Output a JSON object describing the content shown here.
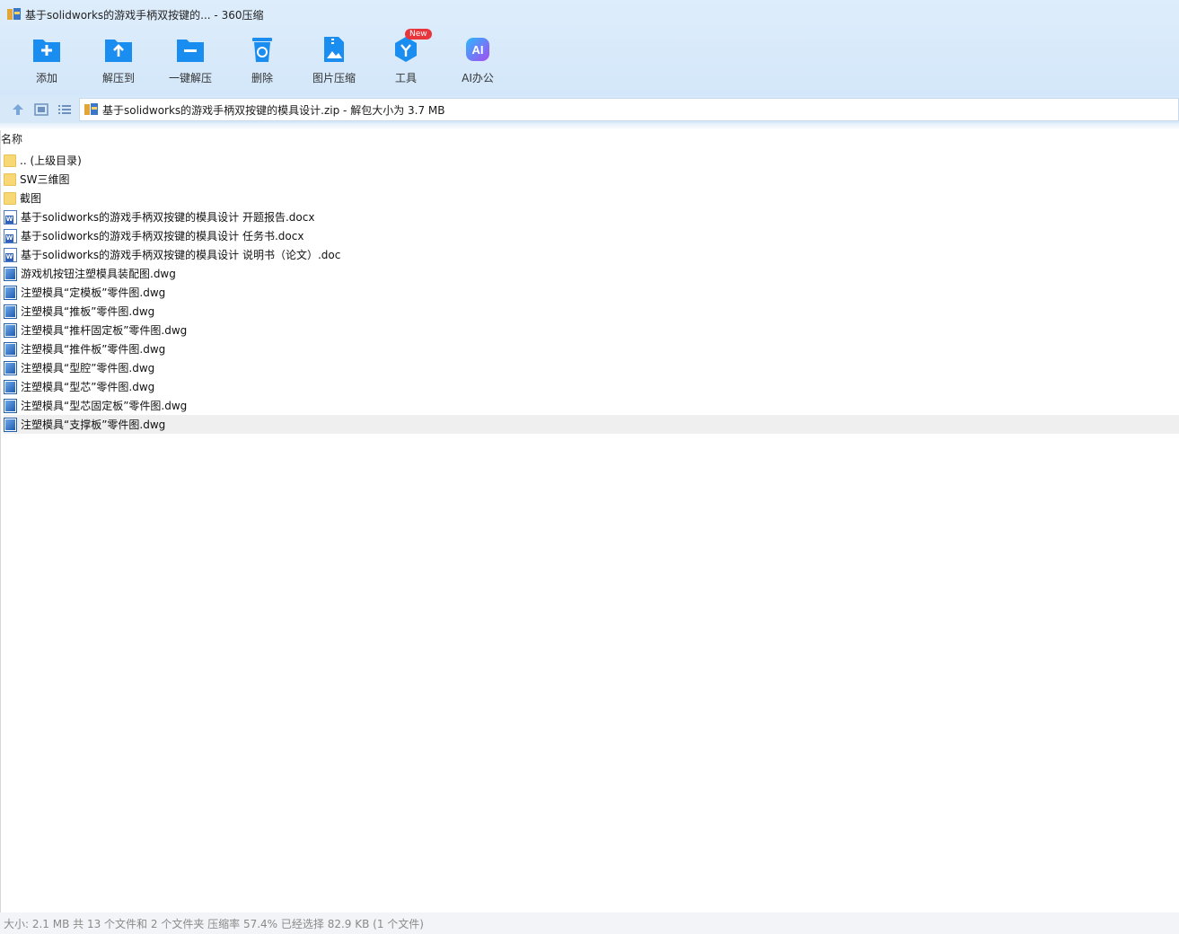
{
  "window": {
    "title": "基于solidworks的游戏手柄双按键的... - 360压缩"
  },
  "colors": {
    "accent": "#1a8ef0",
    "badge": "#e8343b",
    "topbar": "#d8eafa"
  },
  "toolbar": [
    {
      "label": "添加",
      "icon": "add-folder-icon"
    },
    {
      "label": "解压到",
      "icon": "extract-to-icon"
    },
    {
      "label": "一键解压",
      "icon": "one-click-extract-icon"
    },
    {
      "label": "删除",
      "icon": "delete-trash-icon"
    },
    {
      "label": "图片压缩",
      "icon": "image-compress-icon"
    },
    {
      "label": "工具",
      "icon": "tools-icon",
      "badge": "New"
    },
    {
      "label": "AI办公",
      "icon": "ai-office-icon"
    }
  ],
  "address": {
    "path": "基于solidworks的游戏手柄双按键的模具设计.zip - 解包大小为 3.7 MB"
  },
  "list": {
    "column_name": "名称",
    "rows": [
      {
        "name": ".. (上级目录)",
        "type": "folder"
      },
      {
        "name": "SW三维图",
        "type": "folder"
      },
      {
        "name": "截图",
        "type": "folder"
      },
      {
        "name": "基于solidworks的游戏手柄双按键的模具设计 开题报告.docx",
        "type": "word"
      },
      {
        "name": "基于solidworks的游戏手柄双按键的模具设计 任务书.docx",
        "type": "word"
      },
      {
        "name": "基于solidworks的游戏手柄双按键的模具设计 说明书（论文）.doc",
        "type": "word"
      },
      {
        "name": "游戏机按钮注塑模具装配图.dwg",
        "type": "dwg"
      },
      {
        "name": "注塑模具“定模板”零件图.dwg",
        "type": "dwg"
      },
      {
        "name": "注塑模具“推板”零件图.dwg",
        "type": "dwg"
      },
      {
        "name": "注塑模具“推杆固定板”零件图.dwg",
        "type": "dwg"
      },
      {
        "name": "注塑模具“推件板”零件图.dwg",
        "type": "dwg"
      },
      {
        "name": "注塑模具“型腔”零件图.dwg",
        "type": "dwg"
      },
      {
        "name": "注塑模具“型芯”零件图.dwg",
        "type": "dwg"
      },
      {
        "name": "注塑模具“型芯固定板”零件图.dwg",
        "type": "dwg"
      },
      {
        "name": "注塑模具“支撑板”零件图.dwg",
        "type": "dwg",
        "selected": true
      }
    ]
  },
  "status": {
    "text": "大小: 2.1 MB 共 13 个文件和 2 个文件夹 压缩率 57.4% 已经选择 82.9 KB (1 个文件)"
  }
}
